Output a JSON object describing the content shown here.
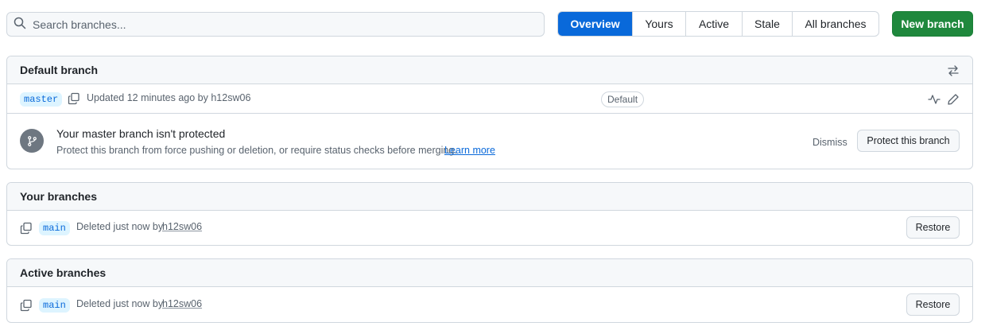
{
  "search": {
    "placeholder": "Search branches...",
    "value": ""
  },
  "tabs": [
    {
      "label": "Overview",
      "selected": true
    },
    {
      "label": "Yours",
      "selected": false
    },
    {
      "label": "Active",
      "selected": false
    },
    {
      "label": "Stale",
      "selected": false
    },
    {
      "label": "All branches",
      "selected": false
    }
  ],
  "new_branch_label": "New branch",
  "default_section": {
    "title": "Default branch",
    "branch": "master",
    "updated_text": "Updated 12 minutes ago by h12sw06",
    "default_label": "Default",
    "protection": {
      "title": "Your master branch isn't protected",
      "description": "Protect this branch from force pushing or deletion, or require status checks before merging.",
      "learn_more": "Learn more",
      "dismiss": "Dismiss",
      "protect_button": "Protect this branch"
    }
  },
  "your_section": {
    "title": "Your branches",
    "branch": "main",
    "status_prefix": "Deleted just now by",
    "author": "h12sw06",
    "restore": "Restore"
  },
  "active_section": {
    "title": "Active branches",
    "branch": "main",
    "status_prefix": "Deleted just now by",
    "author": "h12sw06",
    "restore": "Restore"
  },
  "colors": {
    "accent": "#0969da",
    "primary_button": "#1f883d",
    "border": "#d0d7de"
  }
}
